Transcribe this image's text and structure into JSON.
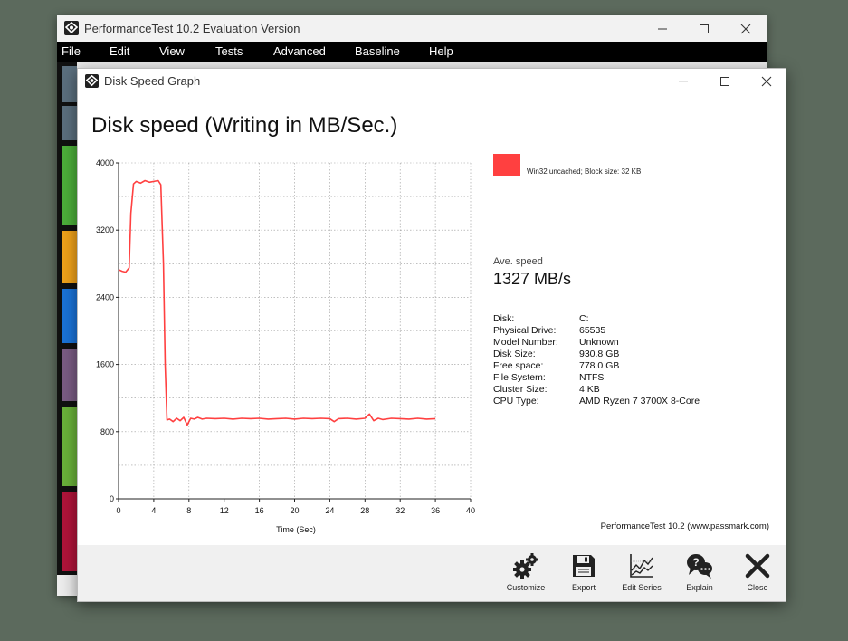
{
  "main_window": {
    "title": "PerformanceTest 10.2 Evaluation Version",
    "menu": [
      "File",
      "Edit",
      "View",
      "Tests",
      "Advanced",
      "Baseline",
      "Help"
    ]
  },
  "dialog": {
    "title": "Disk Speed Graph",
    "graph_title": "Disk speed (Writing in MB/Sec.)"
  },
  "legend": {
    "label": "Win32 uncached; Block size: 32 KB",
    "color": "#ff4040"
  },
  "average": {
    "label": "Ave. speed",
    "value": "1327 MB/s"
  },
  "info": [
    {
      "key": "Disk:",
      "value": "C:"
    },
    {
      "key": "Physical Drive:",
      "value": "65535"
    },
    {
      "key": "Model Number:",
      "value": "Unknown"
    },
    {
      "key": "Disk Size:",
      "value": "930.8 GB"
    },
    {
      "key": "Free space:",
      "value": "778.0 GB"
    },
    {
      "key": "File System:",
      "value": "NTFS"
    },
    {
      "key": "Cluster Size:",
      "value": "4 KB"
    },
    {
      "key": "CPU Type:",
      "value": "AMD Ryzen 7 3700X 8-Core"
    }
  ],
  "credit": "PerformanceTest 10.2 (www.passmark.com)",
  "toolbar": {
    "customize": "Customize",
    "export": "Export",
    "edit_series": "Edit Series",
    "explain": "Explain",
    "close": "Close"
  },
  "chart_data": {
    "type": "line",
    "xlabel": "Time (Sec)",
    "ylabel": "",
    "xlim": [
      0,
      40
    ],
    "ylim": [
      0,
      4000
    ],
    "xticks": [
      0,
      4,
      8,
      12,
      16,
      20,
      24,
      28,
      32,
      36,
      40
    ],
    "yticks": [
      0,
      800,
      1600,
      2400,
      3200,
      4000
    ],
    "grid": true,
    "series": [
      {
        "name": "Win32 uncached; Block size: 32 KB",
        "color": "#ff4040",
        "x": [
          0,
          0.4,
          0.8,
          1.2,
          1.4,
          1.7,
          2.0,
          2.5,
          3.0,
          3.5,
          4.0,
          4.5,
          4.8,
          5.1,
          5.3,
          5.5,
          5.8,
          6.2,
          6.6,
          7.0,
          7.4,
          7.8,
          8.2,
          8.6,
          9.0,
          9.5,
          10.0,
          11,
          12,
          13,
          14,
          15,
          16,
          17,
          18,
          19,
          20,
          21,
          22,
          23,
          24,
          24.5,
          25,
          26,
          27,
          28,
          28.5,
          29,
          29.5,
          30,
          31,
          32,
          33,
          34,
          35,
          36
        ],
        "y": [
          2730,
          2710,
          2700,
          2750,
          3400,
          3750,
          3780,
          3760,
          3790,
          3770,
          3780,
          3790,
          3740,
          2800,
          1600,
          940,
          950,
          920,
          960,
          930,
          970,
          880,
          960,
          950,
          970,
          950,
          960,
          955,
          960,
          950,
          960,
          955,
          960,
          950,
          955,
          960,
          950,
          960,
          955,
          960,
          955,
          920,
          955,
          960,
          950,
          960,
          1010,
          930,
          960,
          945,
          960,
          955,
          950,
          960,
          950,
          955
        ]
      }
    ]
  }
}
